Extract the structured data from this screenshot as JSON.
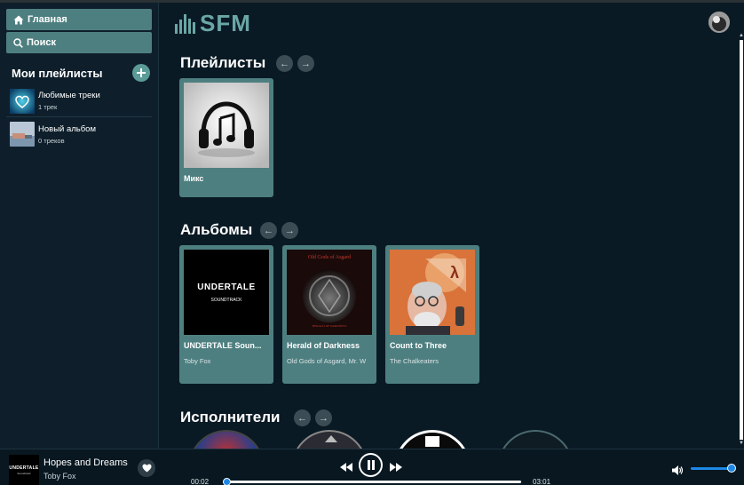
{
  "sidebar": {
    "nav": {
      "home_label": "Главная",
      "search_label": "Поиск"
    },
    "playlists_title": "Мои плейлисты",
    "playlists": [
      {
        "name": "Любимые треки",
        "count": "1 трек"
      },
      {
        "name": "Новый альбом",
        "count": "0 треков"
      }
    ]
  },
  "header": {
    "logo_text": "SFM"
  },
  "sections": {
    "playlists": {
      "title": "Плейлисты",
      "cards": [
        {
          "title": "Микс"
        }
      ]
    },
    "albums": {
      "title": "Альбомы",
      "cards": [
        {
          "title": "UNDERTALE Soun...",
          "subtitle": "Toby Fox",
          "art_text": "UNDERTALE",
          "art_sub": "SOUNDTRACK"
        },
        {
          "title": "Herald of Darkness",
          "subtitle": "Old Gods of Asgard, Mr. W",
          "art_text": "Old Gods of Asgard",
          "art_sub": "HERALD OF DARKNESS"
        },
        {
          "title": "Count to Three",
          "subtitle": "The Chalkeaters"
        }
      ]
    },
    "artists": {
      "title": "Исполнители"
    }
  },
  "player": {
    "track_title": "Hopes and Dreams",
    "track_artist": "Toby Fox",
    "cover_text": "UNDERTALE",
    "cover_sub": "Soundtrack",
    "time_current": "00:02",
    "time_total": "03:01",
    "progress": 0.011,
    "volume": 0.9
  },
  "colors": {
    "accent": "#4e7f80",
    "slider": "#1e88e5",
    "background": "#0a1a24"
  },
  "icons": [
    "home-icon",
    "search-icon",
    "plus-icon",
    "arrow-left-icon",
    "arrow-right-icon",
    "heart-icon",
    "rewind-icon",
    "pause-icon",
    "fast-forward-icon",
    "volume-icon"
  ]
}
